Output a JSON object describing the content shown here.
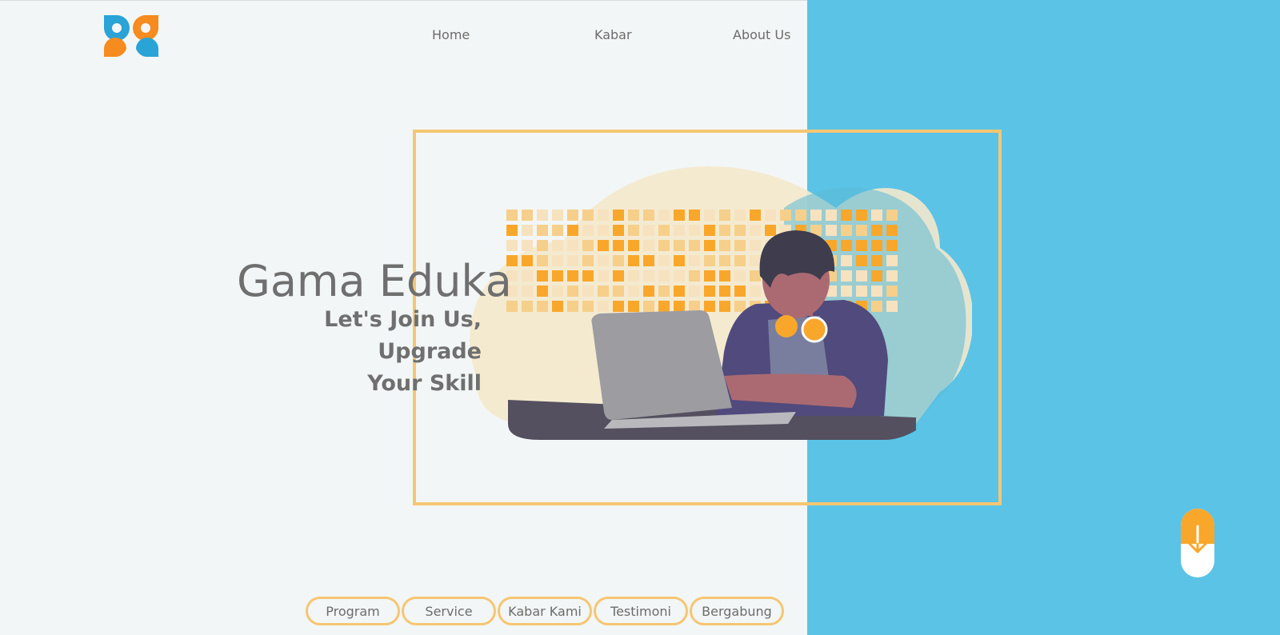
{
  "nav": {
    "items": [
      {
        "label": "Home"
      },
      {
        "label": "Kabar"
      },
      {
        "label": "About Us"
      }
    ]
  },
  "hero": {
    "title": "Gama Eduka",
    "subtitle_line1": "Let's Join Us, Upgrade",
    "subtitle_line2": "Your Skill"
  },
  "sections": {
    "pills": [
      {
        "label": "Program"
      },
      {
        "label": "Service"
      },
      {
        "label": "Kabar Kami"
      },
      {
        "label": "Testimoni"
      },
      {
        "label": "Bergabung"
      }
    ]
  },
  "icons": {
    "logo": "butterfly-logo-icon",
    "scroll": "arrow-down-icon"
  },
  "colors": {
    "accent_blue": "#5bc3e6",
    "accent_orange": "#f9a72b",
    "frame_yellow": "#f5c672",
    "text_gray": "#6f6f6f"
  }
}
